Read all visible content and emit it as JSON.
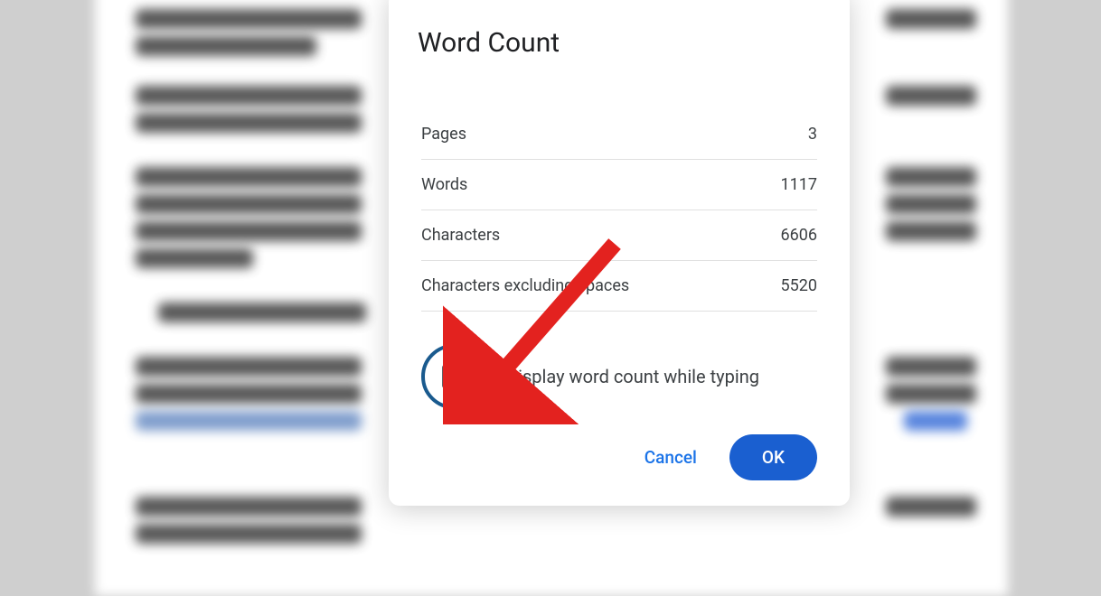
{
  "dialog": {
    "title": "Word Count",
    "stats": {
      "pages_label": "Pages",
      "pages_value": "3",
      "words_label": "Words",
      "words_value": "1117",
      "chars_label": "Characters",
      "chars_value": "6606",
      "chars_no_spaces_label": "Characters excluding spaces",
      "chars_no_spaces_value": "5520"
    },
    "checkbox_label": "Display word count while typing",
    "buttons": {
      "cancel": "Cancel",
      "ok": "OK"
    }
  }
}
